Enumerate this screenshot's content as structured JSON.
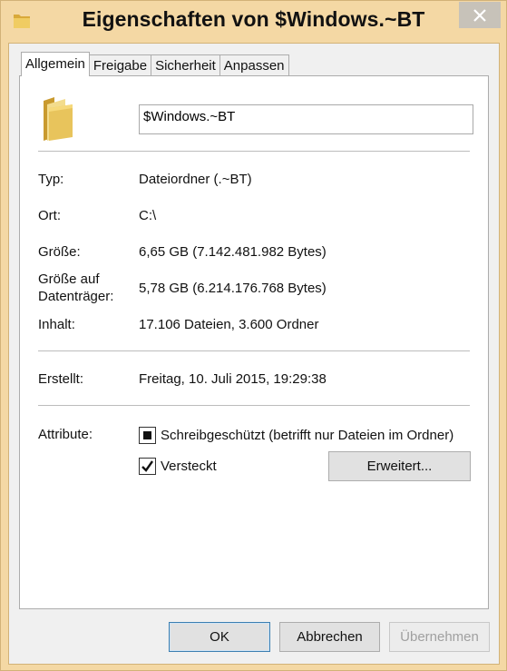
{
  "window": {
    "title": "Eigenschaften von $Windows.~BT"
  },
  "tabs": [
    {
      "label": "Allgemein",
      "active": true
    },
    {
      "label": "Freigabe"
    },
    {
      "label": "Sicherheit"
    },
    {
      "label": "Anpassen"
    }
  ],
  "general": {
    "name_value": "$Windows.~BT",
    "type_label": "Typ:",
    "type_value": "Dateiordner (.~BT)",
    "location_label": "Ort:",
    "location_value": "C:\\",
    "size_label": "Größe:",
    "size_value": "6,65 GB (7.142.481.982 Bytes)",
    "size_on_disk_label_1": "Größe auf",
    "size_on_disk_label_2": "Datenträger:",
    "size_on_disk_value": "5,78 GB (6.214.176.768 Bytes)",
    "contains_label": "Inhalt:",
    "contains_value": "17.106 Dateien, 3.600 Ordner",
    "created_label": "Erstellt:",
    "created_value": "Freitag, 10. Juli 2015, 19:29:38",
    "attributes_label": "Attribute:",
    "readonly_label": "Schreibgeschützt (betrifft nur Dateien im Ordner)",
    "readonly_state": "indeterminate",
    "hidden_label": "Versteckt",
    "hidden_state": "checked",
    "advanced_button": "Erweitert..."
  },
  "footer": {
    "ok": "OK",
    "cancel": "Abbrechen",
    "apply": "Übernehmen"
  },
  "colors": {
    "frame": "#f4d8a4",
    "close_button": "#c7c2b9",
    "folder": "#e8c45c"
  }
}
